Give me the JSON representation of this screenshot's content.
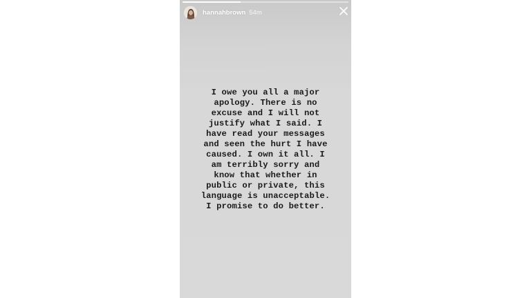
{
  "story": {
    "username": "hannahbrown",
    "timestamp": "54m",
    "progress_fraction": 0.35,
    "message": "I owe you all a major\napology. There is no\nexcuse and I will not\njustify what I said. I\nhave read your messages\nand seen the hurt I have\ncaused. I own it all. I\nam terribly sorry and\nknow that whether in\npublic or private, this\nlanguage is unacceptable.\nI promise to do better.",
    "icons": {
      "avatar": "profile-avatar",
      "close": "close-icon"
    },
    "colors": {
      "background": "#d9d9d9",
      "text": "#1a1a1a",
      "header_text": "#ffffff"
    }
  }
}
